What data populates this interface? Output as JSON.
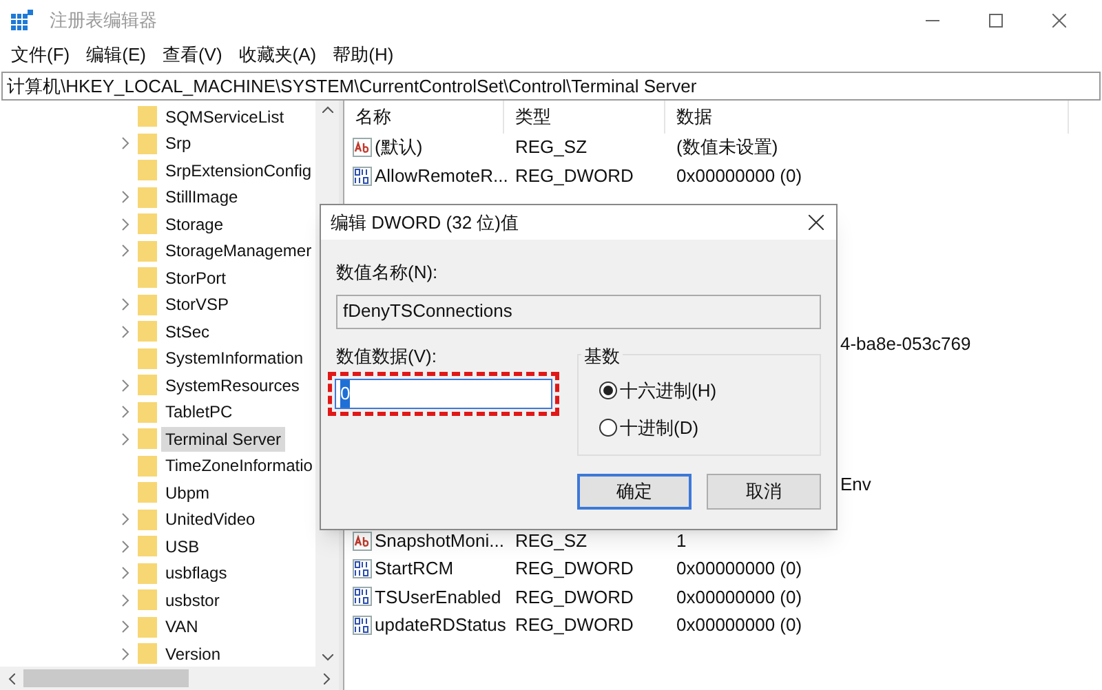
{
  "window": {
    "title": "注册表编辑器"
  },
  "menu": [
    "文件(F)",
    "编辑(E)",
    "查看(V)",
    "收藏夹(A)",
    "帮助(H)"
  ],
  "address": "计算机\\HKEY_LOCAL_MACHINE\\SYSTEM\\CurrentControlSet\\Control\\Terminal Server",
  "tree": [
    {
      "label": "SQMServiceList",
      "expandable": false,
      "selected": false
    },
    {
      "label": "Srp",
      "expandable": true,
      "selected": false
    },
    {
      "label": "SrpExtensionConfig",
      "expandable": false,
      "selected": false
    },
    {
      "label": "StillImage",
      "expandable": true,
      "selected": false
    },
    {
      "label": "Storage",
      "expandable": true,
      "selected": false
    },
    {
      "label": "StorageManagemer",
      "expandable": true,
      "selected": false
    },
    {
      "label": "StorPort",
      "expandable": false,
      "selected": false
    },
    {
      "label": "StorVSP",
      "expandable": true,
      "selected": false
    },
    {
      "label": "StSec",
      "expandable": true,
      "selected": false
    },
    {
      "label": "SystemInformation",
      "expandable": false,
      "selected": false
    },
    {
      "label": "SystemResources",
      "expandable": true,
      "selected": false
    },
    {
      "label": "TabletPC",
      "expandable": true,
      "selected": false
    },
    {
      "label": "Terminal Server",
      "expandable": true,
      "selected": true
    },
    {
      "label": "TimeZoneInformatio",
      "expandable": false,
      "selected": false
    },
    {
      "label": "Ubpm",
      "expandable": false,
      "selected": false
    },
    {
      "label": "UnitedVideo",
      "expandable": true,
      "selected": false
    },
    {
      "label": "USB",
      "expandable": true,
      "selected": false
    },
    {
      "label": "usbflags",
      "expandable": true,
      "selected": false
    },
    {
      "label": "usbstor",
      "expandable": true,
      "selected": false
    },
    {
      "label": "VAN",
      "expandable": true,
      "selected": false
    },
    {
      "label": "Version",
      "expandable": true,
      "selected": false
    }
  ],
  "table": {
    "columns": [
      "名称",
      "类型",
      "数据"
    ],
    "rows": [
      {
        "kind": "string",
        "name": "(默认)",
        "type": "REG_SZ",
        "data": "(数值未设置)"
      },
      {
        "kind": "dword",
        "name": "AllowRemoteR...",
        "type": "REG_DWORD",
        "data": "0x00000000 (0)"
      },
      {
        "kind": "covered"
      },
      {
        "kind": "covered"
      },
      {
        "kind": "covered"
      },
      {
        "kind": "covered"
      },
      {
        "kind": "covered"
      },
      {
        "kind": "fragment",
        "data": "4-ba8e-053c769"
      },
      {
        "kind": "covered"
      },
      {
        "kind": "covered"
      },
      {
        "kind": "covered"
      },
      {
        "kind": "covered"
      },
      {
        "kind": "fragment",
        "data": "Env"
      },
      {
        "kind": "covered"
      },
      {
        "kind": "string",
        "name": "SnapshotMoni...",
        "type": "REG_SZ",
        "data": "1"
      },
      {
        "kind": "dword",
        "name": "StartRCM",
        "type": "REG_DWORD",
        "data": "0x00000000 (0)"
      },
      {
        "kind": "dword",
        "name": "TSUserEnabled",
        "type": "REG_DWORD",
        "data": "0x00000000 (0)"
      },
      {
        "kind": "dword",
        "name": "updateRDStatus",
        "type": "REG_DWORD",
        "data": "0x00000000 (0)"
      }
    ]
  },
  "dialog": {
    "title": "编辑 DWORD (32 位)值",
    "name_label": "数值名称(N):",
    "name_value": "fDenyTSConnections",
    "data_label": "数值数据(V):",
    "data_value": "0",
    "base_label": "基数",
    "radios": [
      {
        "label": "十六进制(H)",
        "selected": true
      },
      {
        "label": "十进制(D)",
        "selected": false
      }
    ],
    "buttons": [
      {
        "label": "确定",
        "default": true
      },
      {
        "label": "取消",
        "default": false
      }
    ]
  }
}
